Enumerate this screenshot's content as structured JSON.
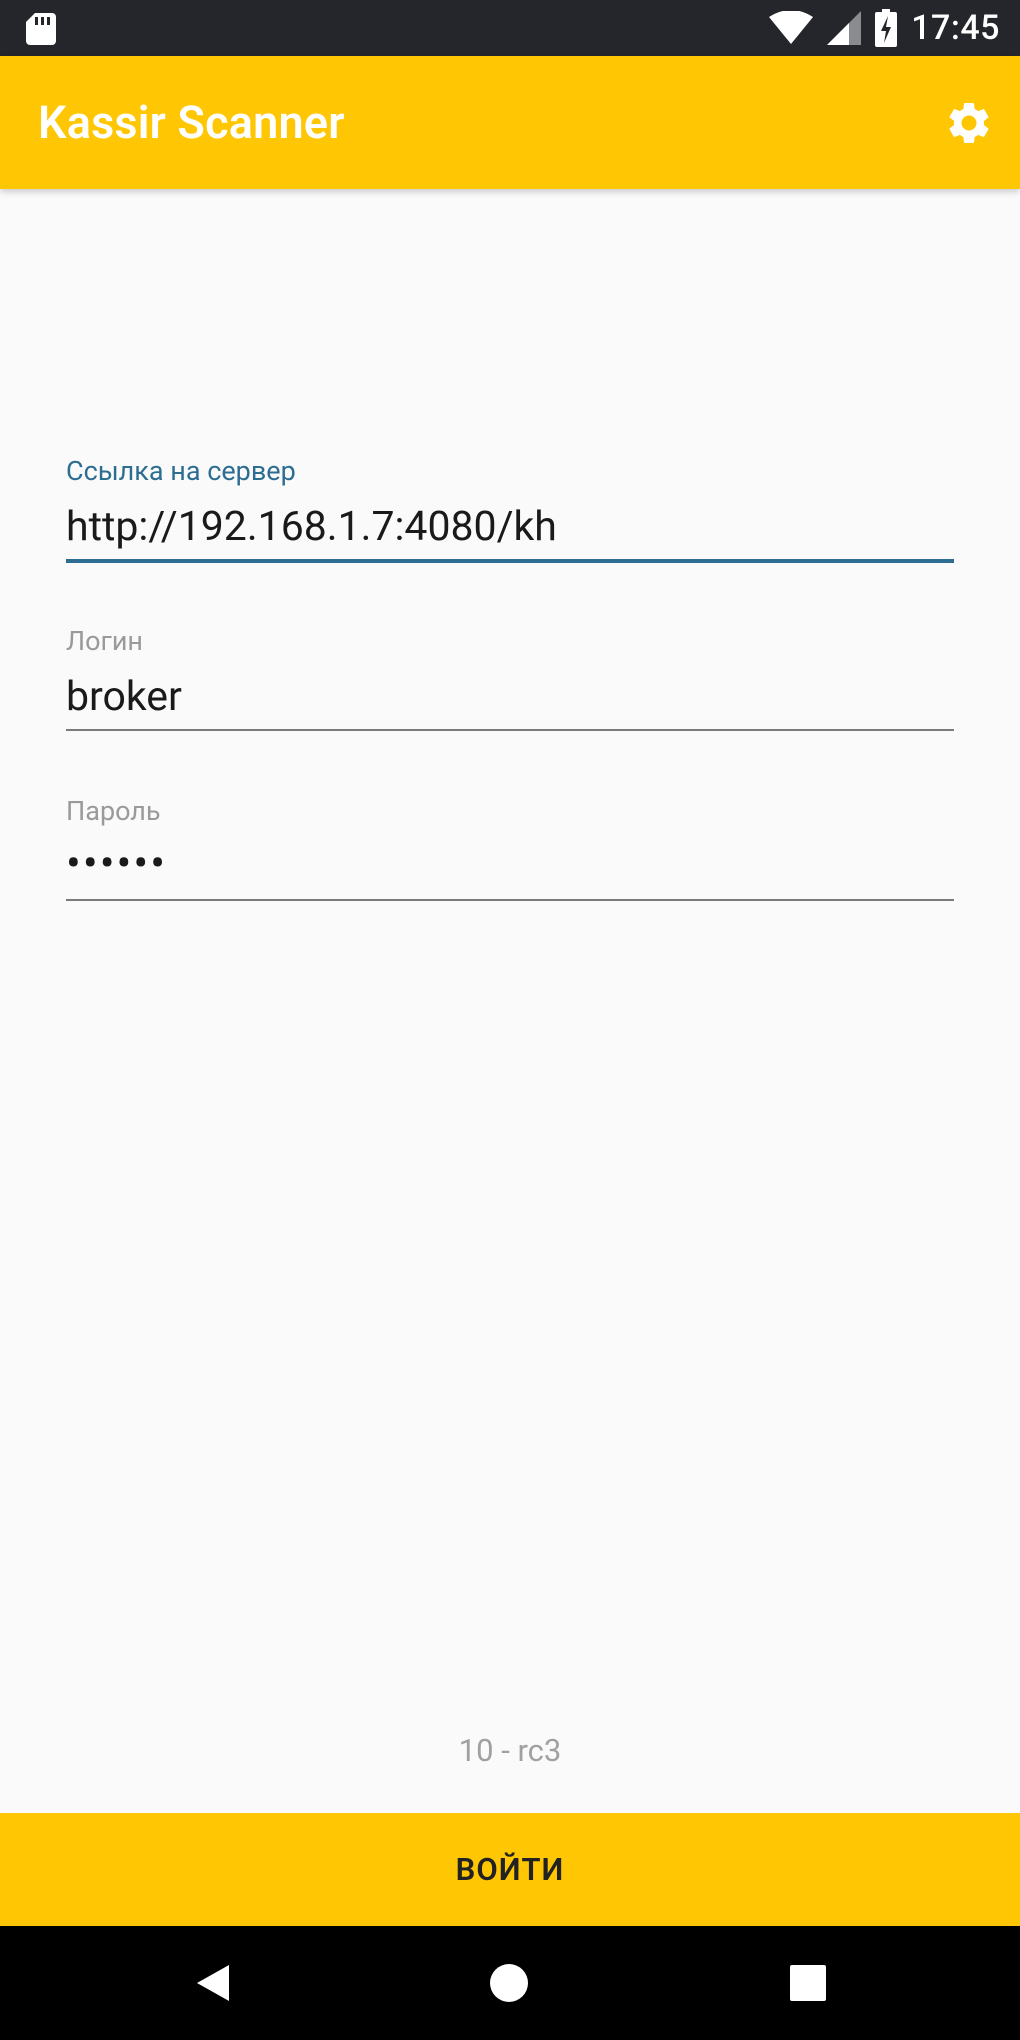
{
  "status_bar": {
    "time": "17:45"
  },
  "app_bar": {
    "title": "Kassir Scanner"
  },
  "form": {
    "server": {
      "label": "Ссылка на сервер",
      "value": "http://192.168.1.7:4080/kh"
    },
    "login": {
      "label": "Логин",
      "value": "broker"
    },
    "password": {
      "label": "Пароль",
      "value": "••••••"
    }
  },
  "version": "10 - rc3",
  "login_button": "ВОЙТИ",
  "colors": {
    "accent": "#ffc603",
    "focus": "#2d6d92"
  }
}
